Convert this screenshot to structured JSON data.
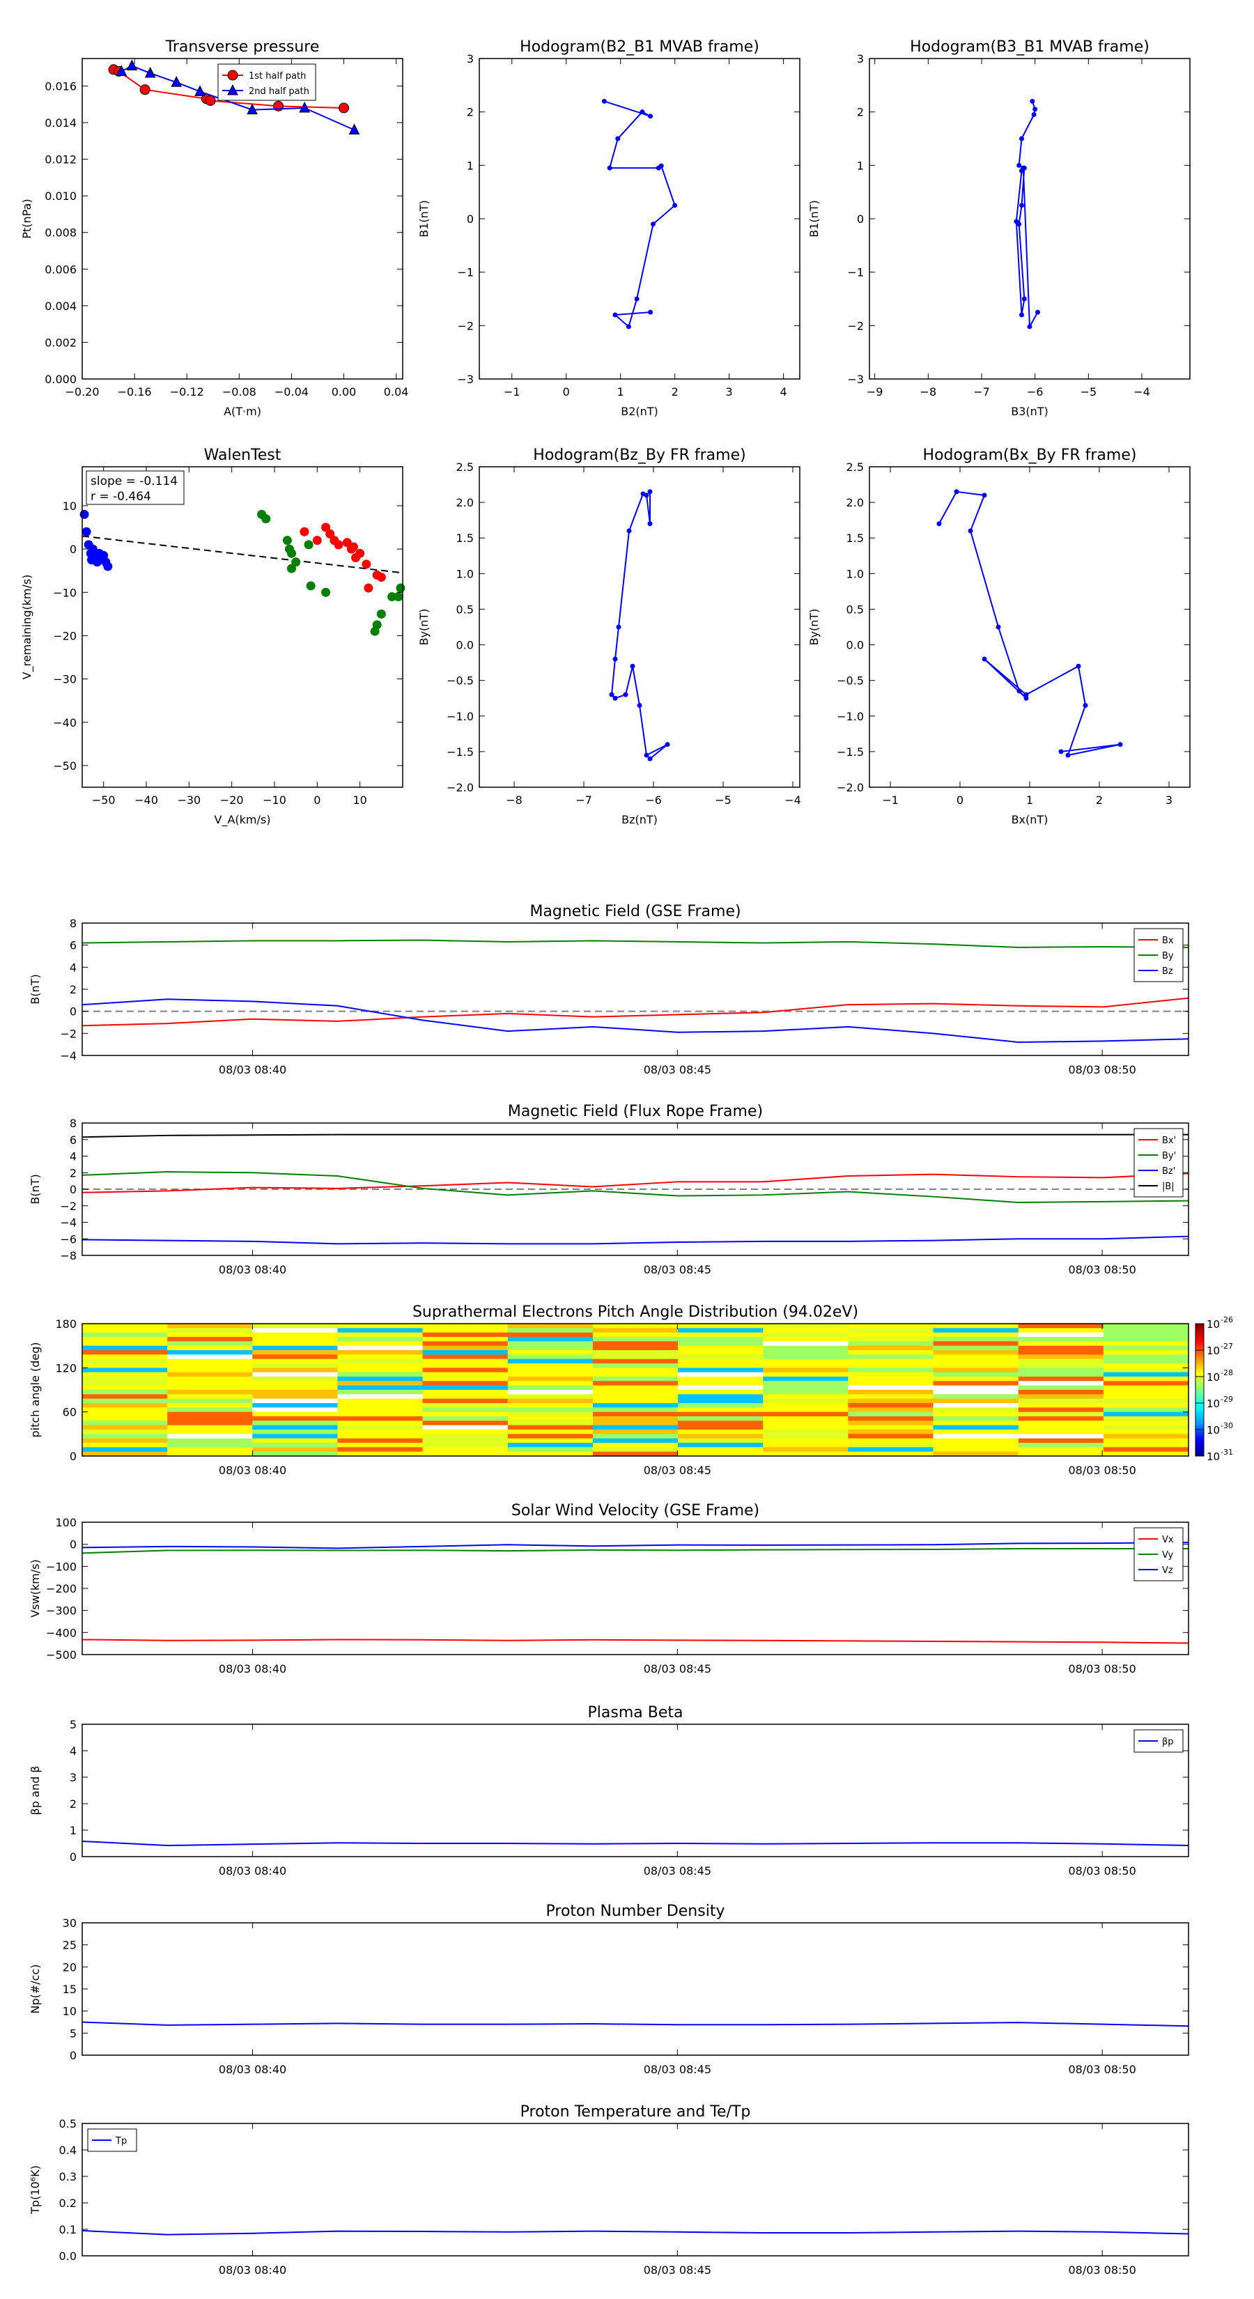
{
  "chart_data": [
    {
      "id": "tp",
      "type": "scatter",
      "title": "Transverse pressure",
      "xlabel": "A(T·m)",
      "ylabel": "Pt(nPa)",
      "xlim": [
        -0.2,
        0.045
      ],
      "ylim": [
        0,
        0.0175
      ],
      "xticks": [
        -0.2,
        -0.16,
        -0.12,
        -0.08,
        -0.04,
        0.0,
        0.04
      ],
      "xtick_labels": [
        "−0.20",
        "−0.16",
        "−0.12",
        "−0.08",
        "−0.04",
        "0.00",
        "0.04"
      ],
      "yticks": [
        0,
        0.002,
        0.004,
        0.006,
        0.008,
        0.01,
        0.012,
        0.014,
        0.016
      ],
      "ytick_labels": [
        "0.000",
        "0.002",
        "0.004",
        "0.006",
        "0.008",
        "0.010",
        "0.012",
        "0.014",
        "0.016"
      ],
      "legend": "top-center",
      "series": [
        {
          "name": "1st half path",
          "color": "#ff0000",
          "marker": "circle",
          "line": true,
          "x": [
            -0.176,
            -0.172,
            -0.152,
            -0.105,
            -0.102,
            -0.05,
            0.0
          ],
          "y": [
            0.0169,
            0.0168,
            0.0158,
            0.0153,
            0.0152,
            0.0149,
            0.0148
          ]
        },
        {
          "name": "2nd half path",
          "color": "#0000ff",
          "marker": "triangle",
          "line": true,
          "x": [
            -0.17,
            -0.162,
            -0.148,
            -0.128,
            -0.11,
            -0.07,
            -0.03,
            0.008
          ],
          "y": [
            0.0168,
            0.0171,
            0.0167,
            0.0162,
            0.0157,
            0.0147,
            0.0148,
            0.0136
          ]
        }
      ]
    },
    {
      "id": "h1",
      "type": "line",
      "title": "Hodogram(B2_B1 MVAB frame)",
      "xlabel": "B2(nT)",
      "ylabel": "B1(nT)",
      "xlim": [
        -1.6,
        4.3
      ],
      "ylim": [
        -3,
        3
      ],
      "xticks": [
        -1,
        0,
        1,
        2,
        3,
        4
      ],
      "xtick_labels": [
        "−1",
        "0",
        "1",
        "2",
        "3",
        "4"
      ],
      "yticks": [
        -3,
        -2,
        -1,
        0,
        1,
        2,
        3
      ],
      "ytick_labels": [
        "−3",
        "−2",
        "−1",
        "0",
        "1",
        "2",
        "3"
      ],
      "series": [
        {
          "color": "#0000ff",
          "marker": "dot",
          "line": true,
          "x": [
            0.7,
            1.55,
            1.4,
            0.95,
            0.8,
            1.7,
            1.75,
            2.0,
            1.6,
            1.3,
            1.15,
            0.9,
            1.55
          ],
          "y": [
            2.2,
            1.92,
            2.0,
            1.5,
            0.95,
            0.95,
            0.99,
            0.25,
            -0.1,
            -1.5,
            -2.02,
            -1.8,
            -1.75
          ]
        }
      ]
    },
    {
      "id": "h2",
      "type": "line",
      "title": "Hodogram(B3_B1 MVAB frame)",
      "xlabel": "B3(nT)",
      "ylabel": "B1(nT)",
      "xlim": [
        -9.1,
        -3.1
      ],
      "ylim": [
        -3,
        3
      ],
      "xticks": [
        -9,
        -8,
        -7,
        -6,
        -5,
        -4
      ],
      "xtick_labels": [
        "−9",
        "−8",
        "−7",
        "−6",
        "−5",
        "−4"
      ],
      "yticks": [
        -3,
        -2,
        -1,
        0,
        1,
        2,
        3
      ],
      "ytick_labels": [
        "−3",
        "−2",
        "−1",
        "0",
        "1",
        "2",
        "3"
      ],
      "series": [
        {
          "color": "#0000ff",
          "marker": "dot",
          "line": true,
          "x": [
            -6.05,
            -6.0,
            -6.02,
            -6.25,
            -6.3,
            -6.2,
            -6.25,
            -6.3,
            -6.2,
            -6.25,
            -6.35,
            -6.25,
            -6.22,
            -6.1,
            -5.95
          ],
          "y": [
            2.2,
            2.05,
            1.95,
            1.5,
            1.0,
            0.95,
            0.25,
            -0.1,
            -1.5,
            -1.8,
            -0.05,
            0.9,
            0.95,
            -2.02,
            -1.75
          ]
        }
      ]
    },
    {
      "id": "walen",
      "type": "scatter",
      "title": "WalenTest",
      "xlabel": "V_A(km/s)",
      "ylabel": "V_remaining(km/s)",
      "xlim": [
        -55,
        20
      ],
      "ylim": [
        -55,
        19
      ],
      "xticks": [
        -50,
        -40,
        -30,
        -20,
        -10,
        0,
        10
      ],
      "xtick_labels": [
        "−50",
        "−40",
        "−30",
        "−20",
        "−10",
        "0",
        "10"
      ],
      "yticks": [
        -50,
        -40,
        -30,
        -20,
        -10,
        0,
        10
      ],
      "ytick_labels": [
        "−50",
        "−40",
        "−30",
        "−20",
        "−10",
        "0",
        "10"
      ],
      "annotation": {
        "slope": "slope = -0.114",
        "r": "r = -0.464"
      },
      "fit_line": {
        "x": [
          -55,
          20
        ],
        "y": [
          3.0,
          -5.5
        ],
        "color": "#000000",
        "style": "dashed"
      },
      "series": [
        {
          "color": "#0000ff",
          "x": [
            -54.5,
            -54,
            -53.5,
            -53,
            -52.5,
            -52,
            -51.5,
            -51,
            -50.5,
            -50,
            -49.5,
            -49,
            -52.8,
            -51.2
          ],
          "y": [
            8,
            4,
            1,
            -1,
            0,
            -2,
            -3,
            -1,
            -2,
            -1.5,
            -3,
            -4,
            -2.5,
            -2.2
          ]
        },
        {
          "color": "#008000",
          "x": [
            -13,
            -12,
            -7,
            -6,
            -6.5,
            -5,
            -2,
            -6,
            2,
            -1.5,
            14,
            13.5,
            15,
            17.5,
            19,
            19.5
          ],
          "y": [
            8,
            7,
            2,
            -1,
            0,
            -3,
            1,
            -4.5,
            -10,
            -8.5,
            -17.5,
            -19,
            -15,
            -11,
            -11,
            -9
          ]
        },
        {
          "color": "#ff0000",
          "x": [
            -3,
            0,
            2,
            3,
            4,
            5,
            7,
            8,
            9,
            10,
            12,
            14,
            15,
            11.5,
            8.5
          ],
          "y": [
            4,
            2,
            5,
            3.5,
            2,
            1,
            1.5,
            0,
            -2,
            -1,
            -9,
            -6,
            -6.5,
            -3.5,
            0.5
          ]
        }
      ]
    },
    {
      "id": "h3",
      "type": "line",
      "title": "Hodogram(Bz_By FR frame)",
      "xlabel": "Bz(nT)",
      "ylabel": "By(nT)",
      "xlim": [
        -8.5,
        -3.9
      ],
      "ylim": [
        -2.0,
        2.5
      ],
      "xticks": [
        -8,
        -7,
        -6,
        -5,
        -4
      ],
      "xtick_labels": [
        "−8",
        "−7",
        "−6",
        "−5",
        "−4"
      ],
      "yticks": [
        -2.0,
        -1.5,
        -1.0,
        -0.5,
        0.0,
        0.5,
        1.0,
        1.5,
        2.0,
        2.5
      ],
      "ytick_labels": [
        "−2.0",
        "−1.5",
        "−1.0",
        "−0.5",
        "0.0",
        "0.5",
        "1.0",
        "1.5",
        "2.0",
        "2.5"
      ],
      "series": [
        {
          "color": "#0000ff",
          "marker": "dot",
          "line": true,
          "x": [
            -6.05,
            -6.05,
            -6.1,
            -6.15,
            -6.35,
            -6.5,
            -6.55,
            -6.6,
            -6.55,
            -6.4,
            -6.3,
            -6.2,
            -6.1,
            -5.8,
            -6.05
          ],
          "y": [
            2.15,
            1.7,
            2.1,
            2.12,
            1.6,
            0.25,
            -0.2,
            -0.7,
            -0.75,
            -0.7,
            -0.3,
            -0.85,
            -1.55,
            -1.4,
            -1.6
          ]
        }
      ]
    },
    {
      "id": "h4",
      "type": "line",
      "title": "Hodogram(Bx_By FR frame)",
      "xlabel": "Bx(nT)",
      "ylabel": "By(nT)",
      "xlim": [
        -1.3,
        3.3
      ],
      "ylim": [
        -2.0,
        2.5
      ],
      "xticks": [
        -1,
        0,
        1,
        2,
        3
      ],
      "xtick_labels": [
        "−1",
        "0",
        "1",
        "2",
        "3"
      ],
      "yticks": [
        -2.0,
        -1.5,
        -1.0,
        -0.5,
        0.0,
        0.5,
        1.0,
        1.5,
        2.0,
        2.5
      ],
      "ytick_labels": [
        "−2.0",
        "−1.5",
        "−1.0",
        "−0.5",
        "0.0",
        "0.5",
        "1.0",
        "1.5",
        "2.0",
        "2.5"
      ],
      "series": [
        {
          "color": "#0000ff",
          "marker": "dot",
          "line": true,
          "x": [
            -0.3,
            -0.05,
            0.35,
            0.15,
            0.55,
            0.85,
            0.95,
            0.35,
            0.95,
            1.7,
            1.8,
            1.55,
            2.3,
            1.45
          ],
          "y": [
            1.7,
            2.15,
            2.1,
            1.6,
            0.25,
            -0.65,
            -0.75,
            -0.2,
            -0.7,
            -0.3,
            -0.85,
            -1.55,
            -1.4,
            -1.5
          ]
        }
      ]
    },
    {
      "id": "mag_gse",
      "type": "line",
      "title": "Magnetic Field (GSE Frame)",
      "ylabel": "B(nT)",
      "ylim": [
        -4,
        8
      ],
      "yticks": [
        -4,
        -2,
        0,
        2,
        4,
        6,
        8
      ],
      "ytick_labels": [
        "−4",
        "−2",
        "0",
        "2",
        "4",
        "6",
        "8"
      ],
      "zero_line": true,
      "legend": "top-right",
      "series": [
        {
          "name": "Bx",
          "color": "#ff0000",
          "y": [
            -1.3,
            -1.1,
            -0.7,
            -0.9,
            -0.5,
            -0.2,
            -0.5,
            -0.3,
            -0.1,
            0.6,
            0.7,
            0.5,
            0.4,
            1.2
          ]
        },
        {
          "name": "By",
          "color": "#008000",
          "y": [
            6.2,
            6.3,
            6.4,
            6.4,
            6.45,
            6.3,
            6.4,
            6.3,
            6.2,
            6.3,
            6.1,
            5.8,
            5.85,
            5.8
          ]
        },
        {
          "name": "Bz",
          "color": "#0000ff",
          "y": [
            0.6,
            1.1,
            0.9,
            0.5,
            -0.8,
            -1.8,
            -1.4,
            -1.9,
            -1.8,
            -1.4,
            -2.0,
            -2.8,
            -2.7,
            -2.5
          ]
        }
      ]
    },
    {
      "id": "mag_fr",
      "type": "line",
      "title": "Magnetic Field (Flux Rope Frame)",
      "ylabel": "B(nT)",
      "ylim": [
        -8,
        8
      ],
      "yticks": [
        -8,
        -6,
        -4,
        -2,
        0,
        2,
        4,
        6,
        8
      ],
      "ytick_labels": [
        "−8",
        "−6",
        "−4",
        "−2",
        "0",
        "2",
        "4",
        "6",
        "8"
      ],
      "zero_line": true,
      "legend": "top-right",
      "series": [
        {
          "name": "Bx'",
          "color": "#ff0000",
          "y": [
            -0.4,
            -0.2,
            0.2,
            0.1,
            0.4,
            0.8,
            0.3,
            0.9,
            0.9,
            1.6,
            1.8,
            1.5,
            1.4,
            1.9
          ]
        },
        {
          "name": "By'",
          "color": "#008000",
          "y": [
            1.7,
            2.1,
            2.0,
            1.6,
            0.1,
            -0.7,
            -0.2,
            -0.8,
            -0.7,
            -0.3,
            -0.9,
            -1.6,
            -1.5,
            -1.4
          ]
        },
        {
          "name": "Bz'",
          "color": "#0000ff",
          "y": [
            -6.1,
            -6.2,
            -6.3,
            -6.6,
            -6.5,
            -6.6,
            -6.6,
            -6.4,
            -6.3,
            -6.3,
            -6.2,
            -6.0,
            -6.0,
            -5.7
          ]
        },
        {
          "name": "|B|",
          "color": "#000000",
          "y": [
            6.3,
            6.5,
            6.55,
            6.6,
            6.6,
            6.6,
            6.6,
            6.6,
            6.6,
            6.6,
            6.6,
            6.6,
            6.6,
            6.6
          ]
        }
      ]
    },
    {
      "id": "pad",
      "type": "heatmap",
      "title": "Suprathermal Electrons Pitch Angle Distribution (94.02eV)",
      "ylabel": "pitch angle (deg)",
      "ylim": [
        0,
        180
      ],
      "yticks": [
        0,
        60,
        120,
        180
      ],
      "ytick_labels": [
        "0",
        "60",
        "120",
        "180"
      ],
      "colorbar": {
        "min_exp": -31,
        "max_exp": -26,
        "labels": [
          "10",
          "10",
          "10",
          "10",
          "10",
          "10"
        ],
        "exponents": [
          "-31",
          "-30",
          "-29",
          "-28",
          "-27",
          "-26"
        ]
      },
      "columns": 13,
      "rows": 30
    },
    {
      "id": "vsw",
      "type": "line",
      "title": "Solar Wind Velocity (GSE Frame)",
      "ylabel": "Vsw(km/s)",
      "ylim": [
        -500,
        100
      ],
      "yticks": [
        -500,
        -400,
        -300,
        -200,
        -100,
        0,
        100
      ],
      "ytick_labels": [
        "−500",
        "−400",
        "−300",
        "−200",
        "−100",
        "0",
        "100"
      ],
      "legend": "top-right",
      "series": [
        {
          "name": "Vx",
          "color": "#ff0000",
          "y": [
            -432,
            -436,
            -435,
            -432,
            -433,
            -436,
            -433,
            -435,
            -436,
            -438,
            -440,
            -442,
            -444,
            -448
          ]
        },
        {
          "name": "Vy",
          "color": "#008000",
          "y": [
            -40,
            -28,
            -27,
            -28,
            -27,
            -30,
            -26,
            -27,
            -25,
            -24,
            -23,
            -20,
            -20,
            -20
          ]
        },
        {
          "name": "Vz",
          "color": "#0000ff",
          "y": [
            -15,
            -10,
            -12,
            -18,
            -10,
            -2,
            -8,
            -3,
            -4,
            -3,
            -2,
            4,
            5,
            8
          ]
        }
      ]
    },
    {
      "id": "beta",
      "type": "line",
      "title": "Plasma Beta",
      "ylabel": "βp and β",
      "ylim": [
        0,
        5
      ],
      "yticks": [
        0,
        1,
        2,
        3,
        4,
        5
      ],
      "ytick_labels": [
        "0",
        "1",
        "2",
        "3",
        "4",
        "5"
      ],
      "legend": "top-right",
      "series": [
        {
          "name": "βp",
          "color": "#0000ff",
          "y": [
            0.58,
            0.42,
            0.47,
            0.52,
            0.5,
            0.5,
            0.48,
            0.5,
            0.48,
            0.5,
            0.52,
            0.52,
            0.48,
            0.42
          ]
        }
      ]
    },
    {
      "id": "np",
      "type": "line",
      "title": "Proton Number Density",
      "ylabel": "Np(#/cc)",
      "ylim": [
        0,
        30
      ],
      "yticks": [
        0,
        5,
        10,
        15,
        20,
        25,
        30
      ],
      "ytick_labels": [
        "0",
        "5",
        "10",
        "15",
        "20",
        "25",
        "30"
      ],
      "series": [
        {
          "color": "#0000ff",
          "y": [
            7.5,
            6.8,
            7.0,
            7.2,
            7.0,
            7.0,
            7.1,
            6.9,
            6.9,
            7.0,
            7.2,
            7.4,
            7.0,
            6.6
          ]
        }
      ]
    },
    {
      "id": "tp2",
      "type": "line",
      "title": "Proton Temperature and Te/Tp",
      "ylabel": "Tp(10⁶K)",
      "ylim": [
        0,
        0.5
      ],
      "yticks": [
        0.0,
        0.1,
        0.2,
        0.3,
        0.4,
        0.5
      ],
      "ytick_labels": [
        "0.0",
        "0.1",
        "0.2",
        "0.3",
        "0.4",
        "0.5"
      ],
      "legend": "top-left",
      "series": [
        {
          "name": "Tp",
          "color": "#0000ff",
          "y": [
            0.095,
            0.08,
            0.085,
            0.093,
            0.092,
            0.09,
            0.093,
            0.09,
            0.087,
            0.087,
            0.09,
            0.093,
            0.09,
            0.083
          ]
        }
      ]
    }
  ],
  "time_axis": {
    "ticks": [
      {
        "label": "08/03 08:40",
        "frac": 0.154
      },
      {
        "label": "08/03 08:45",
        "frac": 0.538
      },
      {
        "label": "08/03 08:50",
        "frac": 0.922
      }
    ]
  }
}
